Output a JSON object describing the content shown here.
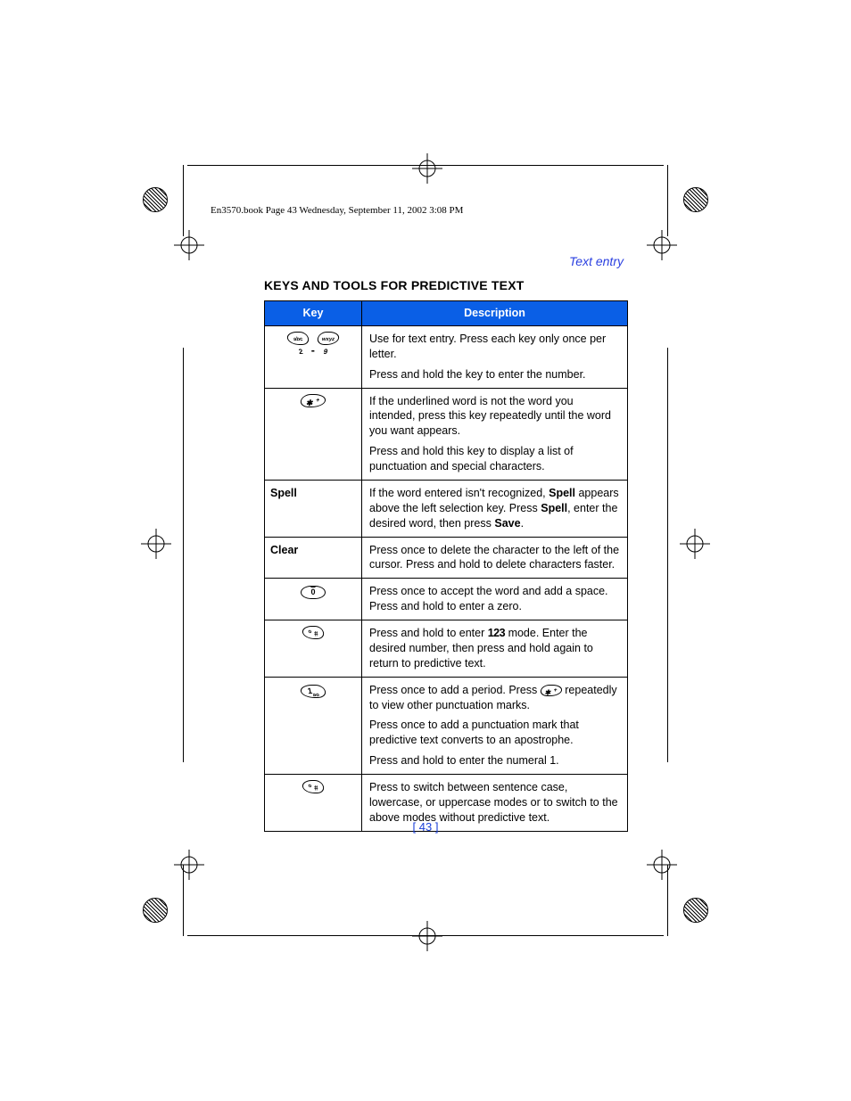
{
  "header_line": "En3570.book  Page 43  Wednesday, September 11, 2002  3:08 PM",
  "section_label": "Text entry",
  "section_title": "KEYS AND TOOLS FOR PREDICTIVE TEXT",
  "table": {
    "col_key": "Key",
    "col_desc": "Description",
    "rows": [
      {
        "key_type": "range_2_9",
        "desc_html": "<p>Use for text entry. Press each key only once per letter.</p><p>Press and hold the key to enter the number.</p>"
      },
      {
        "key_type": "star",
        "desc_html": "<p>If the underlined word is not the word you intended, press this key repeatedly until the word you want appears.</p><p>Press and hold this key to display a list of punctuation and special characters.</p>"
      },
      {
        "key_type": "text",
        "key_text": "Spell",
        "desc_html": "<p>If the word entered isn't recognized, <b>Spell</b> appears above the left selection key. Press <b>Spell</b>, enter the desired word, then press <b>Save</b>.</p>"
      },
      {
        "key_type": "text",
        "key_text": "Clear",
        "desc_html": "<p>Press once to delete the character to the left of the cursor. Press and hold to delete characters faster.</p>"
      },
      {
        "key_type": "zero",
        "desc_html": "<p>Press once to accept the word and add a space. Press and hold to enter a zero.</p>"
      },
      {
        "key_type": "pound",
        "desc_html": "<p>Press and hold to enter <span class='mode123'>123</span> mode. Enter the desired number, then press and hold again to return to predictive text.</p>"
      },
      {
        "key_type": "one",
        "desc_html": "<p>Press once to add a period. Press <span class='key-oval key-skew-l inline-key'>✱ <sup>+</sup></span> repeatedly to view other punctuation marks.</p><p>Press once to add a punctuation mark that predictive text converts to an apostrophe.</p><p>Press and hold to enter the numeral 1.</p>"
      },
      {
        "key_type": "pound2",
        "desc_html": "<p>Press to switch between sentence case, lowercase, or uppercase modes or to switch to the above modes without predictive text.</p>"
      }
    ]
  },
  "page_number": "[ 43 ]"
}
